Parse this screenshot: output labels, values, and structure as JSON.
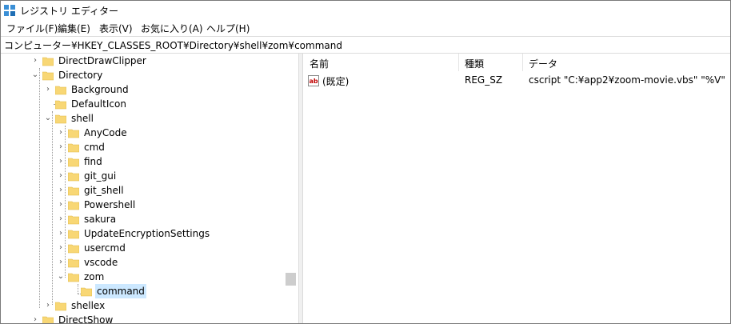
{
  "window": {
    "title": "レジストリ エディター"
  },
  "menu": {
    "items": [
      "ファイル(F)",
      "編集(E)",
      "表示(V)",
      "お気に入り(A)",
      "ヘルプ(H)"
    ]
  },
  "address": {
    "path": "コンピューター¥HKEY_CLASSES_ROOT¥Directory¥shell¥zom¥command"
  },
  "tree": {
    "items": [
      {
        "label": "DirectDrawClipper",
        "chevron": "›"
      },
      {
        "label": "Directory",
        "chevron": "⌄"
      },
      {
        "label": "Background",
        "chevron": "›"
      },
      {
        "label": "DefaultIcon",
        "chevron": ""
      },
      {
        "label": "shell",
        "chevron": "⌄"
      },
      {
        "label": "AnyCode",
        "chevron": "›"
      },
      {
        "label": "cmd",
        "chevron": "›"
      },
      {
        "label": "find",
        "chevron": "›"
      },
      {
        "label": "git_gui",
        "chevron": "›"
      },
      {
        "label": "git_shell",
        "chevron": "›"
      },
      {
        "label": "Powershell",
        "chevron": "›"
      },
      {
        "label": "sakura",
        "chevron": "›"
      },
      {
        "label": "UpdateEncryptionSettings",
        "chevron": "›"
      },
      {
        "label": "usercmd",
        "chevron": "›"
      },
      {
        "label": "vscode",
        "chevron": "›"
      },
      {
        "label": "zom",
        "chevron": "⌄"
      },
      {
        "label": "command",
        "chevron": ""
      },
      {
        "label": "shellex",
        "chevron": "›"
      },
      {
        "label": "DirectShow",
        "chevron": "›"
      }
    ]
  },
  "list": {
    "columns": {
      "name": "名前",
      "type": "種類",
      "data": "データ"
    },
    "rows": [
      {
        "name": "(既定)",
        "type": "REG_SZ",
        "data": "cscript \"C:¥app2¥zoom-movie.vbs\" \"%V\"",
        "icon": "string-value-icon"
      }
    ]
  },
  "colors": {
    "selection": "#cce8ff",
    "folder": "#f8d775",
    "folder_edge": "#e0b840"
  }
}
